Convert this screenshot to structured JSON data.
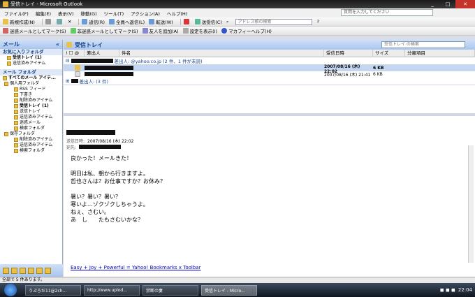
{
  "window": {
    "title": "受信トレイ - Microsoft Outlook"
  },
  "menu": [
    "ファイル(F)",
    "編集(E)",
    "表示(V)",
    "移動(G)",
    "ツール(T)",
    "アクション(A)",
    "ヘルプ(H)"
  ],
  "help_placeholder": "質問を入力してください",
  "toolbar1": {
    "new": "新規作成(N)",
    "reply": "返信(R)",
    "reply_all": "全員へ返信(L)",
    "forward": "転送(W)",
    "send_receive": "送受信(C)",
    "address_placeholder": "アドレス帳の検索"
  },
  "toolbar2": {
    "junk": "迷惑メールとしてマーク(S)",
    "not_junk": "非迷惑メールとしてマーク(S)",
    "add_sender": "友人を追加(A)",
    "settings": "設定を表示(I)",
    "mcafee": "マカフィーヘルプ(H)"
  },
  "nav": {
    "title": "メール",
    "favorites_label": "お気に入りフォルダ",
    "favorites": [
      {
        "label": "受信トレイ (1)",
        "bold": true
      },
      {
        "label": "送信済みアイテム",
        "bold": false
      }
    ],
    "mail_folders_label": "メール フォルダ",
    "all_items": "すべてのメール アイテ...",
    "tree": [
      {
        "label": "個人用フォルダ",
        "indent": 0
      },
      {
        "label": "RSS フィード",
        "indent": 1
      },
      {
        "label": "下書き",
        "indent": 1
      },
      {
        "label": "削除済みアイテム",
        "indent": 1
      },
      {
        "label": "受信トレイ (1)",
        "indent": 1,
        "bold": true
      },
      {
        "label": "送信トレイ",
        "indent": 1
      },
      {
        "label": "送信済みアイテム",
        "indent": 1
      },
      {
        "label": "迷惑メール",
        "indent": 1
      },
      {
        "label": "検索フォルダ",
        "indent": 1
      },
      {
        "label": "保存フォルダ",
        "indent": 0
      },
      {
        "label": "削除済みアイテム",
        "indent": 1
      },
      {
        "label": "送信済みアイテム",
        "indent": 1
      },
      {
        "label": "検索フォルダ",
        "indent": 1
      }
    ]
  },
  "list": {
    "folder_title": "受信トレイ",
    "search_placeholder": "受信トレイ の検索",
    "columns": [
      "差出人",
      "件名",
      "受信日時",
      "サイズ",
      "分類項目"
    ],
    "group1": "差出人: @yahoo.co.jp (2 件、1 件が未読)",
    "rows": [
      {
        "date": "2007/08/16 (木) 22:02",
        "size": "6 KB",
        "unread": true
      },
      {
        "date": "2007/08/16 (木) 21:41",
        "size": "6 KB",
        "unread": false
      }
    ],
    "group2": "差出人: (3 件)"
  },
  "reading": {
    "date_label": "送信日時:",
    "date_value": "2007/08/16 (木) 22:02",
    "to_label": "宛先:",
    "body": [
      "良かった！メールきた！",
      "",
      "明日は私、朝から行きますよ。",
      "哲也さんは？お仕事ですか？お休み？",
      "",
      "暑い？暑い？暑い？",
      "寒いよ…ゾクゾクしちゃうよ。",
      "ねぇ、さむい。",
      "あ　し　　たもさむいかな？"
    ],
    "footer": "Easy + Joy + Powerful = Yahoo! Bookmarks x Toolbar"
  },
  "status": "全部で 5 件あります。",
  "taskbar": {
    "tasks": [
      "うぷろだ11@2ch...",
      "http://www.uplod...",
      "禁断の妻",
      "受信トレイ - Micro..."
    ],
    "clock": "22:04"
  }
}
